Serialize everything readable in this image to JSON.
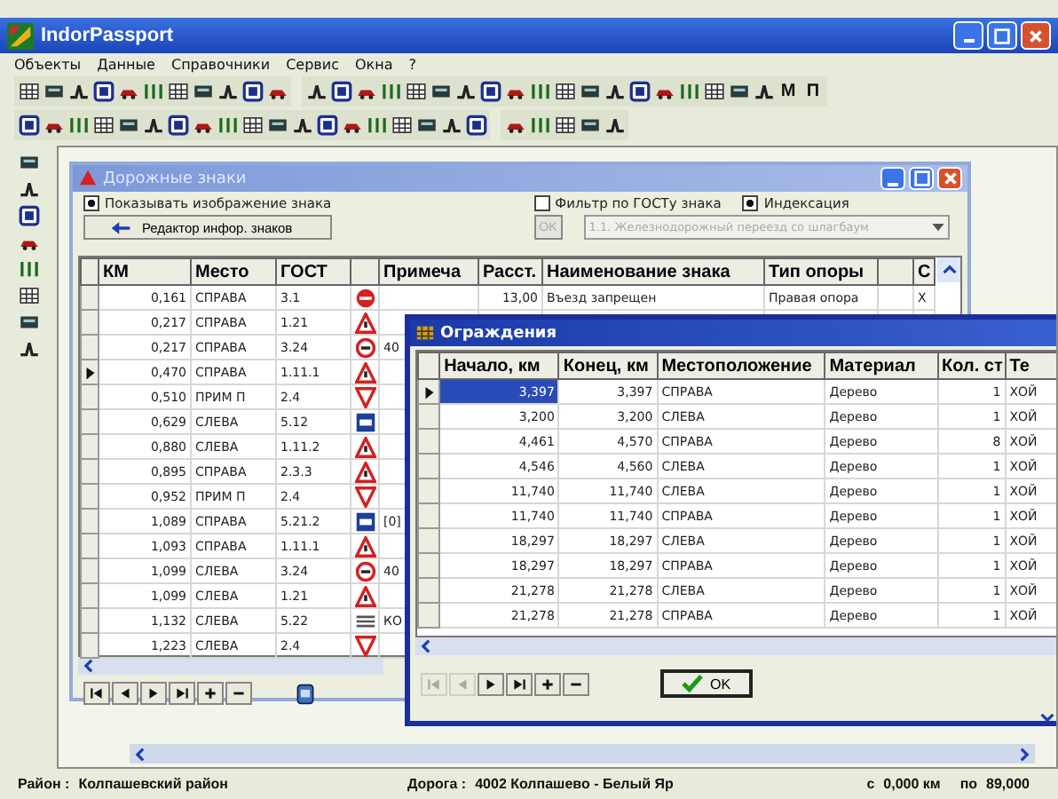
{
  "window": {
    "title": "IndorPassport"
  },
  "menu": [
    "Объекты",
    "Данные",
    "Справочники",
    "Сервис",
    "Окна",
    "?"
  ],
  "toolbar_text_buttons": [
    "M",
    "П"
  ],
  "signs_window": {
    "title": "Дорожные знаки",
    "show_images": {
      "label": "Показывать изображение знака",
      "checked": true
    },
    "editor_button": "Редактор инфор. знаков",
    "gost_filter": {
      "label": "Фильтр по ГОСТу знака",
      "checked": false
    },
    "indexing": {
      "label": "Индексация",
      "checked": true
    },
    "ok_button": {
      "label": "OK",
      "disabled": true
    },
    "dropdown": {
      "value": "1.1. Железнодорожный переезд со шлагбаум",
      "disabled": true
    },
    "columns": [
      "КМ",
      "Место",
      "ГОСТ",
      "",
      "Примеча",
      "Расст.",
      "Наименование знака",
      "Тип опоры",
      "",
      "С"
    ],
    "rows": [
      {
        "current": false,
        "km": "0,161",
        "place": "СПРАВА",
        "gost": "3.1",
        "kind": "no-entry",
        "dist": "13,00",
        "name": "Въезд запрещен",
        "support": "Правая опора",
        "c": "X"
      },
      {
        "current": false,
        "km": "0,217",
        "place": "СПРАВА",
        "gost": "1.21",
        "kind": "warning"
      },
      {
        "current": false,
        "km": "0,217",
        "place": "СПРАВА",
        "gost": "3.24",
        "kind": "limit",
        "note": "40"
      },
      {
        "current": true,
        "km": "0,470",
        "place": "СПРАВА",
        "gost": "1.11.1",
        "kind": "warning"
      },
      {
        "current": false,
        "km": "0,510",
        "place": "ПРИМ П",
        "gost": "2.4",
        "kind": "yield"
      },
      {
        "current": false,
        "km": "0,629",
        "place": "СЛЕВА",
        "gost": "5.12",
        "kind": "info"
      },
      {
        "current": false,
        "km": "0,880",
        "place": "СЛЕВА",
        "gost": "1.11.2",
        "kind": "warning"
      },
      {
        "current": false,
        "km": "0,895",
        "place": "СПРАВА",
        "gost": "2.3.3",
        "kind": "warning"
      },
      {
        "current": false,
        "km": "0,952",
        "place": "ПРИМ П",
        "gost": "2.4",
        "kind": "yield"
      },
      {
        "current": false,
        "km": "1,089",
        "place": "СПРАВА",
        "gost": "5.21.2",
        "kind": "info",
        "note": "[0]"
      },
      {
        "current": false,
        "km": "1,093",
        "place": "СПРАВА",
        "gost": "1.11.1",
        "kind": "warning"
      },
      {
        "current": false,
        "km": "1,099",
        "place": "СЛЕВА",
        "gost": "3.24",
        "kind": "limit",
        "note": "40"
      },
      {
        "current": false,
        "km": "1,099",
        "place": "СЛЕВА",
        "gost": "1.21",
        "kind": "warning"
      },
      {
        "current": false,
        "km": "1,132",
        "place": "СЛЕВА",
        "gost": "5.22",
        "kind": "lanes",
        "note": "КО"
      },
      {
        "current": false,
        "km": "1,223",
        "place": "СЛЕВА",
        "gost": "2.4",
        "kind": "yield"
      }
    ],
    "nav": [
      {
        "kind": "first",
        "disabled": false
      },
      {
        "kind": "prev",
        "disabled": false
      },
      {
        "kind": "next",
        "disabled": false
      },
      {
        "kind": "last",
        "disabled": false
      },
      {
        "kind": "add",
        "disabled": false
      },
      {
        "kind": "remove",
        "disabled": false
      }
    ]
  },
  "fences_window": {
    "title": "Ограждения",
    "columns": [
      "Начало, км",
      "Конец, км",
      "Местоположение",
      "Материал",
      "Кол. ст",
      "Те"
    ],
    "rows": [
      {
        "current": true,
        "selected": true,
        "start": "3,397",
        "end": "3,397",
        "place": "СПРАВА",
        "material": "Дерево",
        "count": "1",
        "type": "ХОЙ"
      },
      {
        "current": false,
        "selected": false,
        "start": "3,200",
        "end": "3,200",
        "place": "СЛЕВА",
        "material": "Дерево",
        "count": "1",
        "type": "ХОЙ"
      },
      {
        "current": false,
        "selected": false,
        "start": "4,461",
        "end": "4,570",
        "place": "СПРАВА",
        "material": "Дерево",
        "count": "8",
        "type": "ХОЙ"
      },
      {
        "current": false,
        "selected": false,
        "start": "4,546",
        "end": "4,560",
        "place": "СЛЕВА",
        "material": "Дерево",
        "count": "1",
        "type": "ХОЙ"
      },
      {
        "current": false,
        "selected": false,
        "start": "11,740",
        "end": "11,740",
        "place": "СЛЕВА",
        "material": "Дерево",
        "count": "1",
        "type": "ХОЙ"
      },
      {
        "current": false,
        "selected": false,
        "start": "11,740",
        "end": "11,740",
        "place": "СПРАВА",
        "material": "Дерево",
        "count": "1",
        "type": "ХОЙ"
      },
      {
        "current": false,
        "selected": false,
        "start": "18,297",
        "end": "18,297",
        "place": "СЛЕВА",
        "material": "Дерево",
        "count": "1",
        "type": "ХОЙ"
      },
      {
        "current": false,
        "selected": false,
        "start": "18,297",
        "end": "18,297",
        "place": "СПРАВА",
        "material": "Дерево",
        "count": "1",
        "type": "ХОЙ"
      },
      {
        "current": false,
        "selected": false,
        "start": "21,278",
        "end": "21,278",
        "place": "СЛЕВА",
        "material": "Дерево",
        "count": "1",
        "type": "ХОЙ"
      },
      {
        "current": false,
        "selected": false,
        "start": "21,278",
        "end": "21,278",
        "place": "СПРАВА",
        "material": "Дерево",
        "count": "1",
        "type": "ХОЙ"
      }
    ],
    "nav": [
      {
        "kind": "first",
        "disabled": true
      },
      {
        "kind": "prev",
        "disabled": true
      },
      {
        "kind": "next",
        "disabled": false
      },
      {
        "kind": "last",
        "disabled": false
      },
      {
        "kind": "add",
        "disabled": false
      },
      {
        "kind": "remove",
        "disabled": false
      }
    ],
    "ok_button": "OK"
  },
  "status_bar": {
    "region_label": "Район :",
    "region": "Колпашевский район",
    "road_label": "Дорога :",
    "road": "4002 Колпашево - Белый Яр",
    "from_label": "с",
    "from": "0,000 км",
    "to_label": "по",
    "to": "89,000"
  }
}
